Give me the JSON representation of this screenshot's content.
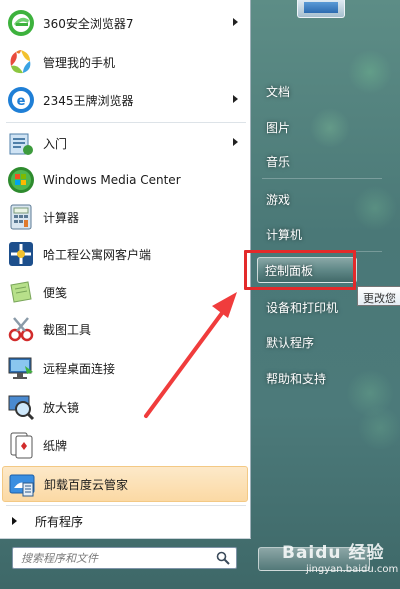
{
  "programs": [
    {
      "label": "360安全浏览器7",
      "icon": "360-browser-icon",
      "has_submenu": true
    },
    {
      "label": "管理我的手机",
      "icon": "phone-manager-icon",
      "has_submenu": false
    },
    {
      "label": "2345王牌浏览器",
      "icon": "2345-browser-icon",
      "has_submenu": true
    },
    {
      "label": "入门",
      "icon": "getting-started-icon",
      "has_submenu": true
    },
    {
      "label": "Windows Media Center",
      "icon": "media-center-icon",
      "has_submenu": false
    },
    {
      "label": "计算器",
      "icon": "calculator-icon",
      "has_submenu": false
    },
    {
      "label": "哈工程公寓网客户端",
      "icon": "campus-net-icon",
      "has_submenu": false
    },
    {
      "label": "便笺",
      "icon": "sticky-notes-icon",
      "has_submenu": false
    },
    {
      "label": "截图工具",
      "icon": "snipping-tool-icon",
      "has_submenu": false
    },
    {
      "label": "远程桌面连接",
      "icon": "remote-desktop-icon",
      "has_submenu": false
    },
    {
      "label": "放大镜",
      "icon": "magnifier-icon",
      "has_submenu": false
    },
    {
      "label": "纸牌",
      "icon": "solitaire-icon",
      "has_submenu": false
    },
    {
      "label": "卸载百度云管家",
      "icon": "uninstall-baidu-icon",
      "has_submenu": false
    }
  ],
  "all_programs_label": "所有程序",
  "search": {
    "placeholder": "搜索程序和文件"
  },
  "right_links": {
    "documents": "文档",
    "pictures": "图片",
    "music": "音乐",
    "games": "游戏",
    "computer": "计算机",
    "control_panel": "控制面板",
    "devices_printers": "设备和打印机",
    "default_programs": "默认程序",
    "help_support": "帮助和支持"
  },
  "tooltip": "更改您",
  "watermark": {
    "main": "Baidu 经验",
    "sub": "jingyan.baidu.com"
  },
  "colors": {
    "highlight_box": "#e32a2a",
    "arrow": "#f03c3c",
    "selected_item": "#fbd9a4"
  }
}
